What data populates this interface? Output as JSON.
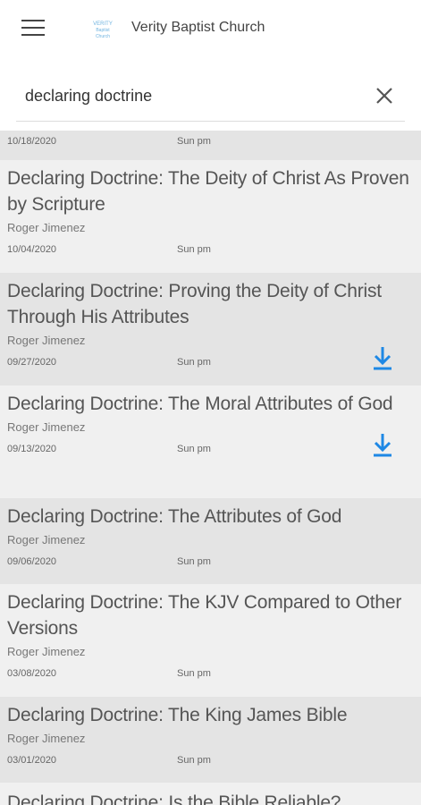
{
  "header": {
    "title": "Verity Baptist Church",
    "logo_text": [
      "VERITY",
      "Baptist",
      "Church"
    ]
  },
  "search": {
    "value": "declaring doctrine"
  },
  "top_partial": {
    "date": "10/18/2020",
    "service": "Sun pm"
  },
  "sermons": [
    {
      "title": "Declaring Doctrine: The Deity of Christ As Proven by Scripture",
      "speaker": "Roger Jimenez",
      "date": "10/04/2020",
      "service": "Sun pm",
      "downloaded": false
    },
    {
      "title": "Declaring Doctrine: Proving the Deity of Christ Through His Attributes",
      "speaker": "Roger Jimenez",
      "date": "09/27/2020",
      "service": "Sun pm",
      "downloaded": true
    },
    {
      "title": "Declaring Doctrine: The Moral Attributes of God",
      "speaker": "Roger Jimenez",
      "date": "09/13/2020",
      "service": "Sun pm",
      "downloaded": true
    },
    {
      "title": "Declaring Doctrine: The Attributes of God",
      "speaker": "Roger Jimenez",
      "date": "09/06/2020",
      "service": "Sun pm",
      "downloaded": false
    },
    {
      "title": "Declaring Doctrine: The KJV Compared to Other Versions",
      "speaker": "Roger Jimenez",
      "date": "03/08/2020",
      "service": "Sun pm",
      "downloaded": false
    },
    {
      "title": "Declaring Doctrine: The King James Bible",
      "speaker": "Roger Jimenez",
      "date": "03/01/2020",
      "service": "Sun pm",
      "downloaded": false
    }
  ],
  "bottom_partial": {
    "title": "Declaring Doctrine: Is the Bible Reliable?"
  },
  "colors": {
    "download_icon": "#1e88e5",
    "row_dark": "#e4e4e4",
    "row_light": "#f0f0f0"
  }
}
